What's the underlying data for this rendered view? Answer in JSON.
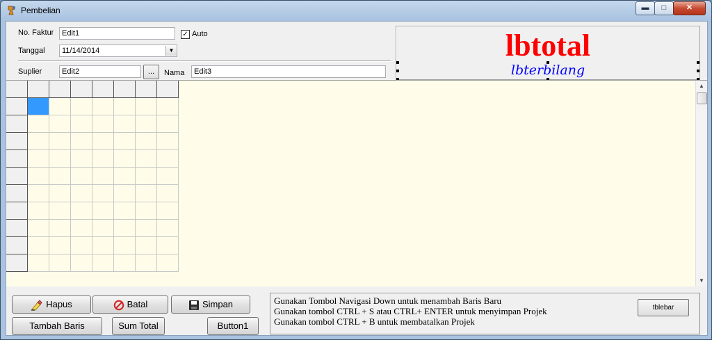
{
  "window": {
    "title": "Pembelian",
    "controls": {
      "minimize": "▬",
      "maximize": "□",
      "close": "✕"
    }
  },
  "header": {
    "no_faktur_label": "No. Faktur",
    "no_faktur_value": "Edit1",
    "auto_checked": true,
    "auto_label": "Auto",
    "tanggal_label": "Tanggal",
    "tanggal_value": "11/14/2014",
    "suplier_label": "Suplier",
    "suplier_value": "Edit2",
    "browse_label": "...",
    "nama_label": "Nama",
    "nama_value": "Edit3"
  },
  "totals": {
    "lbtotal": "lbtotal",
    "lbterbilang": "lbterbilang"
  },
  "grid": {
    "columns": 8,
    "rows": 11,
    "background": "#fffde9",
    "selected_cell_color": "#3399ff"
  },
  "buttons": {
    "hapus": "Hapus",
    "batal": "Batal",
    "simpan": "Simpan",
    "tambah_baris": "Tambah Baris",
    "sum_total": "Sum Total",
    "button1": "Button1",
    "tblebar": "tblebar"
  },
  "info": {
    "line1": "Gunakan Tombol Navigasi Down untuk menambah Baris Baru",
    "line2": "Gunakan tombol CTRL + S atau  CTRL+ ENTER untuk menyimpan Projek",
    "line3": "Gunakan tombol CTRL + B untuk membatalkan Projek"
  }
}
